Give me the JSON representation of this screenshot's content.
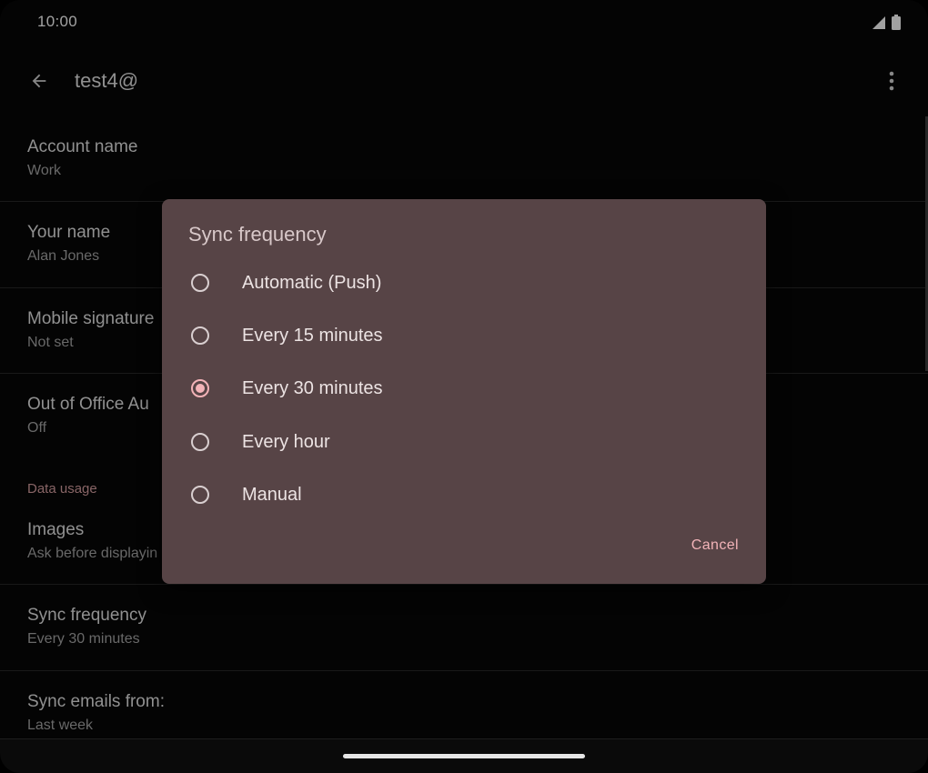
{
  "status_bar": {
    "time": "10:00",
    "icons": [
      "cell-signal-icon",
      "battery-icon"
    ]
  },
  "app_bar": {
    "title": "test4@",
    "back_icon": "arrow-back-icon",
    "overflow_icon": "more-vert-icon"
  },
  "settings": {
    "account_name": {
      "title": "Account name",
      "value": "Work"
    },
    "your_name": {
      "title": "Your name",
      "value": "Alan Jones"
    },
    "mobile_signature": {
      "title": "Mobile signature",
      "value": "Not set"
    },
    "out_of_office": {
      "title": "Out of Office Au",
      "value": "Off"
    },
    "data_usage_header": "Data usage",
    "images": {
      "title": "Images",
      "value": "Ask before displayin"
    },
    "sync_frequency": {
      "title": "Sync frequency",
      "value": "Every 30 minutes"
    },
    "sync_emails_from": {
      "title": "Sync emails from:",
      "value": "Last week"
    }
  },
  "dialog": {
    "title": "Sync frequency",
    "options": [
      {
        "label": "Automatic (Push)",
        "selected": false
      },
      {
        "label": "Every 15 minutes",
        "selected": false
      },
      {
        "label": "Every 30 minutes",
        "selected": true
      },
      {
        "label": "Every hour",
        "selected": false
      },
      {
        "label": "Manual",
        "selected": false
      }
    ],
    "cancel_label": "Cancel"
  },
  "colors": {
    "background": "#060606",
    "dialog_bg": "#574446",
    "accent": "#f2b3b8",
    "section_header": "#c99597"
  }
}
